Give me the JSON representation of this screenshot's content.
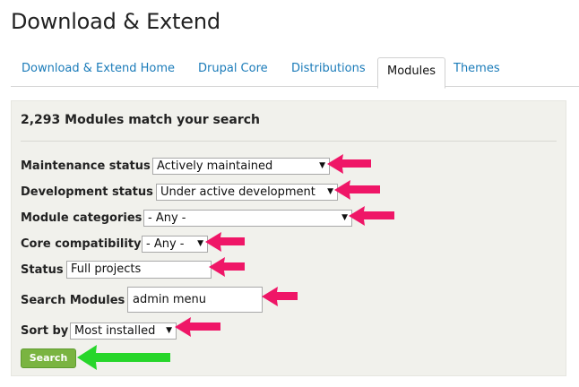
{
  "page": {
    "title": "Download & Extend"
  },
  "tabs": [
    {
      "label": "Download & Extend Home"
    },
    {
      "label": "Drupal Core"
    },
    {
      "label": "Distributions"
    },
    {
      "label": "Modules"
    },
    {
      "label": "Themes"
    }
  ],
  "panel": {
    "result_count": "2,293 Modules match your search",
    "fields": {
      "maintenance": {
        "label": "Maintenance status",
        "value": "Actively maintained"
      },
      "development": {
        "label": "Development status",
        "value": "Under active development"
      },
      "categories": {
        "label": "Module categories",
        "value": "- Any -"
      },
      "core": {
        "label": "Core compatibility",
        "value": "- Any -"
      },
      "status": {
        "label": "Status",
        "value": "Full projects"
      },
      "search": {
        "label": "Search Modules",
        "value": "admin menu"
      },
      "sort": {
        "label": "Sort by",
        "value": "Most installed"
      }
    },
    "submit_label": "Search"
  },
  "colors": {
    "link": "#1a7bb9",
    "button": "#7ab441",
    "annotation_arrow_pink": "#ef1667",
    "annotation_arrow_green": "#27d62a"
  },
  "icons": {
    "select_arrow": "▼"
  }
}
